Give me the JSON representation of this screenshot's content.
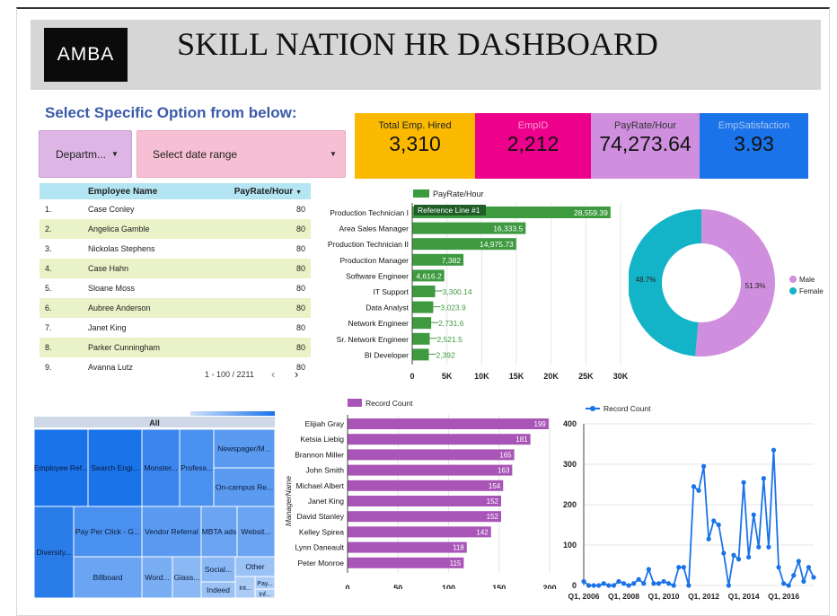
{
  "header": {
    "logo": "AMBA",
    "title": "SKILL NATION HR DASHBOARD"
  },
  "controls": {
    "label": "Select Specific Option from below:",
    "department": "Departm...",
    "date_range": "Select date range"
  },
  "kpis": [
    {
      "label": "Total Emp. Hired",
      "value": "3,310"
    },
    {
      "label": "EmpID",
      "value": "2,212"
    },
    {
      "label": "PayRate/Hour",
      "value": "74,273.64"
    },
    {
      "label": "EmpSatisfaction",
      "value": "3.93"
    }
  ],
  "colors": {
    "kpi1": "#fbba00",
    "kpi2": "#ec008c",
    "kpi3": "#cf8fde",
    "kpi4": "#1a73e8",
    "green": "#3d9a3f",
    "purple": "#a855b7",
    "blue": "#1a73e8",
    "teal": "#14b4c8"
  },
  "table": {
    "headers": {
      "name": "Employee Name",
      "pay": "PayRate/Hour"
    },
    "rows": [
      {
        "n": "1.",
        "name": "Case Conley",
        "pay": "80"
      },
      {
        "n": "2.",
        "name": "Angelica Gamble",
        "pay": "80"
      },
      {
        "n": "3.",
        "name": "Nickolas Stephens",
        "pay": "80"
      },
      {
        "n": "4.",
        "name": "Case Hahn",
        "pay": "80"
      },
      {
        "n": "5.",
        "name": "Sloane Moss",
        "pay": "80"
      },
      {
        "n": "6.",
        "name": "Aubree Anderson",
        "pay": "80"
      },
      {
        "n": "7.",
        "name": "Janet King",
        "pay": "80"
      },
      {
        "n": "8.",
        "name": "Parker Cunningham",
        "pay": "80"
      },
      {
        "n": "9.",
        "name": "Ayanna Lutz",
        "pay": "80"
      }
    ],
    "pager": "1 - 100 / 2211",
    "prev_icon": "‹",
    "next_icon": "›"
  },
  "treemap": {
    "root": "All",
    "cells": [
      "Employee Ref...",
      "Search Engi...",
      "Monster...",
      "Profess...",
      "Newspager/M...",
      "On-campus Re...",
      "Diversity...",
      "Pay Per Click - G...",
      "Vendor Referral",
      "MBTA ads",
      "Websit...",
      "Billboard",
      "Word...",
      "Glass...",
      "Social...",
      "Other",
      "Indeed",
      "Int...",
      "Pay...",
      "Inf..."
    ]
  },
  "chart_data": [
    {
      "type": "bar",
      "orientation": "horizontal",
      "legend": "PayRate/Hour",
      "annotation": "Reference Line #1",
      "categories": [
        "Production Technician I",
        "Area Sales Manager",
        "Production Technician II",
        "Production Manager",
        "Software Engineer",
        "IT Support",
        "Data Analyst",
        "Network Engineer",
        "Sr. Network Engineer",
        "BI Developer"
      ],
      "values": [
        28559.39,
        16333.5,
        14975.73,
        7382,
        4616.2,
        3300.14,
        3023.9,
        2731.6,
        2521.5,
        2392
      ],
      "value_labels": [
        "28,559.39",
        "16,333.5",
        "14,975.73",
        "7,382",
        "4,616.2",
        "3,300.14",
        "3,023.9",
        "2,731.6",
        "2,521.5",
        "2,392"
      ],
      "xticks": [
        "0",
        "5K",
        "10K",
        "15K",
        "20K",
        "25K",
        "30K"
      ],
      "xlim": [
        0,
        30000
      ]
    },
    {
      "type": "pie",
      "donut": true,
      "categories": [
        "Male",
        "Female"
      ],
      "values": [
        51.3,
        48.7
      ],
      "value_labels": [
        "51.3%",
        "48.7%"
      ],
      "legend_position": "right"
    },
    {
      "type": "bar",
      "orientation": "horizontal",
      "legend": "Record Count",
      "ylabel": "ManagerName",
      "categories": [
        "Elijiah Gray",
        "Ketsia Liebig",
        "Brannon Miller",
        "John Smith",
        "Michael Albert",
        "Janet King",
        "David Stanley",
        "Kelley Spirea",
        "Lynn Daneault",
        "Peter Monroe"
      ],
      "values": [
        199,
        181,
        165,
        163,
        154,
        152,
        152,
        142,
        118,
        115
      ],
      "xticks": [
        "0",
        "50",
        "100",
        "150",
        "200"
      ],
      "xlim": [
        0,
        200
      ]
    },
    {
      "type": "line",
      "legend": "Record Count",
      "x": [
        "2006Q1",
        "2006Q2",
        "2006Q3",
        "2006Q4",
        "2007Q1",
        "2007Q2",
        "2007Q3",
        "2007Q4",
        "2008Q1",
        "2008Q2",
        "2008Q3",
        "2008Q4",
        "2009Q1",
        "2009Q2",
        "2009Q3",
        "2009Q4",
        "2010Q1",
        "2010Q2",
        "2010Q3",
        "2010Q4",
        "2011Q1",
        "2011Q2",
        "2011Q3",
        "2011Q4",
        "2012Q1",
        "2012Q2",
        "2012Q3",
        "2012Q4",
        "2013Q1",
        "2013Q2",
        "2013Q3",
        "2013Q4",
        "2014Q1",
        "2014Q2",
        "2014Q3",
        "2014Q4",
        "2015Q1",
        "2015Q2",
        "2015Q3",
        "2015Q4",
        "2016Q1",
        "2016Q2",
        "2016Q3",
        "2016Q4",
        "2017Q1",
        "2017Q2",
        "2017Q3"
      ],
      "values": [
        10,
        0,
        0,
        0,
        5,
        0,
        0,
        10,
        5,
        0,
        5,
        15,
        5,
        40,
        5,
        5,
        10,
        5,
        0,
        45,
        45,
        0,
        245,
        235,
        295,
        115,
        160,
        150,
        80,
        0,
        75,
        65,
        255,
        70,
        175,
        95,
        265,
        95,
        335,
        45,
        5,
        0,
        25,
        60,
        10,
        45,
        20
      ],
      "yticks": [
        "0",
        "100",
        "200",
        "300",
        "400"
      ],
      "ylim": [
        0,
        400
      ],
      "xticks": [
        "Q1, 2006",
        "Q1, 2008",
        "Q1, 2010",
        "Q1, 2012",
        "Q1, 2014",
        "Q1, 2016"
      ]
    }
  ]
}
